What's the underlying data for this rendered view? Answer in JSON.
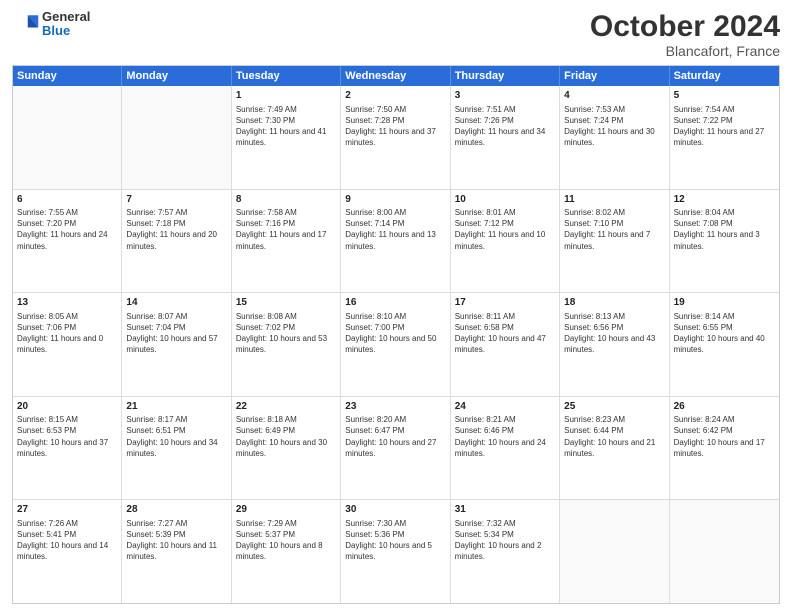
{
  "logo": {
    "general": "General",
    "blue": "Blue"
  },
  "header": {
    "month": "October 2024",
    "location": "Blancafort, France"
  },
  "days": [
    "Sunday",
    "Monday",
    "Tuesday",
    "Wednesday",
    "Thursday",
    "Friday",
    "Saturday"
  ],
  "weeks": [
    [
      {
        "day": "",
        "info": ""
      },
      {
        "day": "",
        "info": ""
      },
      {
        "day": "1",
        "info": "Sunrise: 7:49 AM\nSunset: 7:30 PM\nDaylight: 11 hours and 41 minutes."
      },
      {
        "day": "2",
        "info": "Sunrise: 7:50 AM\nSunset: 7:28 PM\nDaylight: 11 hours and 37 minutes."
      },
      {
        "day": "3",
        "info": "Sunrise: 7:51 AM\nSunset: 7:26 PM\nDaylight: 11 hours and 34 minutes."
      },
      {
        "day": "4",
        "info": "Sunrise: 7:53 AM\nSunset: 7:24 PM\nDaylight: 11 hours and 30 minutes."
      },
      {
        "day": "5",
        "info": "Sunrise: 7:54 AM\nSunset: 7:22 PM\nDaylight: 11 hours and 27 minutes."
      }
    ],
    [
      {
        "day": "6",
        "info": "Sunrise: 7:55 AM\nSunset: 7:20 PM\nDaylight: 11 hours and 24 minutes."
      },
      {
        "day": "7",
        "info": "Sunrise: 7:57 AM\nSunset: 7:18 PM\nDaylight: 11 hours and 20 minutes."
      },
      {
        "day": "8",
        "info": "Sunrise: 7:58 AM\nSunset: 7:16 PM\nDaylight: 11 hours and 17 minutes."
      },
      {
        "day": "9",
        "info": "Sunrise: 8:00 AM\nSunset: 7:14 PM\nDaylight: 11 hours and 13 minutes."
      },
      {
        "day": "10",
        "info": "Sunrise: 8:01 AM\nSunset: 7:12 PM\nDaylight: 11 hours and 10 minutes."
      },
      {
        "day": "11",
        "info": "Sunrise: 8:02 AM\nSunset: 7:10 PM\nDaylight: 11 hours and 7 minutes."
      },
      {
        "day": "12",
        "info": "Sunrise: 8:04 AM\nSunset: 7:08 PM\nDaylight: 11 hours and 3 minutes."
      }
    ],
    [
      {
        "day": "13",
        "info": "Sunrise: 8:05 AM\nSunset: 7:06 PM\nDaylight: 11 hours and 0 minutes."
      },
      {
        "day": "14",
        "info": "Sunrise: 8:07 AM\nSunset: 7:04 PM\nDaylight: 10 hours and 57 minutes."
      },
      {
        "day": "15",
        "info": "Sunrise: 8:08 AM\nSunset: 7:02 PM\nDaylight: 10 hours and 53 minutes."
      },
      {
        "day": "16",
        "info": "Sunrise: 8:10 AM\nSunset: 7:00 PM\nDaylight: 10 hours and 50 minutes."
      },
      {
        "day": "17",
        "info": "Sunrise: 8:11 AM\nSunset: 6:58 PM\nDaylight: 10 hours and 47 minutes."
      },
      {
        "day": "18",
        "info": "Sunrise: 8:13 AM\nSunset: 6:56 PM\nDaylight: 10 hours and 43 minutes."
      },
      {
        "day": "19",
        "info": "Sunrise: 8:14 AM\nSunset: 6:55 PM\nDaylight: 10 hours and 40 minutes."
      }
    ],
    [
      {
        "day": "20",
        "info": "Sunrise: 8:15 AM\nSunset: 6:53 PM\nDaylight: 10 hours and 37 minutes."
      },
      {
        "day": "21",
        "info": "Sunrise: 8:17 AM\nSunset: 6:51 PM\nDaylight: 10 hours and 34 minutes."
      },
      {
        "day": "22",
        "info": "Sunrise: 8:18 AM\nSunset: 6:49 PM\nDaylight: 10 hours and 30 minutes."
      },
      {
        "day": "23",
        "info": "Sunrise: 8:20 AM\nSunset: 6:47 PM\nDaylight: 10 hours and 27 minutes."
      },
      {
        "day": "24",
        "info": "Sunrise: 8:21 AM\nSunset: 6:46 PM\nDaylight: 10 hours and 24 minutes."
      },
      {
        "day": "25",
        "info": "Sunrise: 8:23 AM\nSunset: 6:44 PM\nDaylight: 10 hours and 21 minutes."
      },
      {
        "day": "26",
        "info": "Sunrise: 8:24 AM\nSunset: 6:42 PM\nDaylight: 10 hours and 17 minutes."
      }
    ],
    [
      {
        "day": "27",
        "info": "Sunrise: 7:26 AM\nSunset: 5:41 PM\nDaylight: 10 hours and 14 minutes."
      },
      {
        "day": "28",
        "info": "Sunrise: 7:27 AM\nSunset: 5:39 PM\nDaylight: 10 hours and 11 minutes."
      },
      {
        "day": "29",
        "info": "Sunrise: 7:29 AM\nSunset: 5:37 PM\nDaylight: 10 hours and 8 minutes."
      },
      {
        "day": "30",
        "info": "Sunrise: 7:30 AM\nSunset: 5:36 PM\nDaylight: 10 hours and 5 minutes."
      },
      {
        "day": "31",
        "info": "Sunrise: 7:32 AM\nSunset: 5:34 PM\nDaylight: 10 hours and 2 minutes."
      },
      {
        "day": "",
        "info": ""
      },
      {
        "day": "",
        "info": ""
      }
    ]
  ]
}
